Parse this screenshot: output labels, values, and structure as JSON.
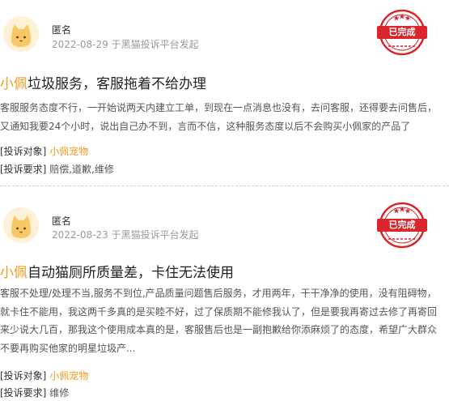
{
  "complaints": [
    {
      "author": "匿名",
      "date": "2022-08-29",
      "platform": "于黑猫投诉平台发起",
      "status": "已完成",
      "title_brand": "小佩",
      "title_rest": "垃圾服务，客服拖着不给办理",
      "body": "客服服务态度不行，一开始说两天内建立工单，到现在一点消息也没有，去问客服，还得要去问售后，又通知我要24个小时，说出自己办不到，言而不信，这种服务态度以后不会购买小佩家的产品了",
      "target_label": "[投诉对象]",
      "target_value": "小佩宠物",
      "request_label": "[投诉要求]",
      "request_value": "赔偿,道歉,维修"
    },
    {
      "author": "匿名",
      "date": "2022-08-23",
      "platform": "于黑猫投诉平台发起",
      "status": "已完成",
      "title_brand": "小佩",
      "title_rest": "自动猫厕所质量差，卡住无法使用",
      "body": "客服不处理/处理不当,服务不到位,产品质量问题售后服务，才用两年，干干净净的使用，没有阻碍物，就卡住不能用，我这两千多真的是买睦不好，过了保质期不能修我认了，但是要我再寄过去修了再寄回来少说大几百，那我这个使用成本真的是，客服售后也是一副抱歉给你添麻烦了的态度，希望广大群众不要再购买他家的明星垃圾产...",
      "target_label": "[投诉对象]",
      "target_value": "小佩宠物",
      "request_label": "[投诉要求]",
      "request_value": "维修"
    }
  ],
  "colors": {
    "brand": "#f39a1e",
    "stamp": "#d9252b",
    "avatar_bg": "#fdf1d8"
  },
  "icons": {
    "avatar": "cat-avatar-icon",
    "stamp": "completed-stamp-icon"
  }
}
